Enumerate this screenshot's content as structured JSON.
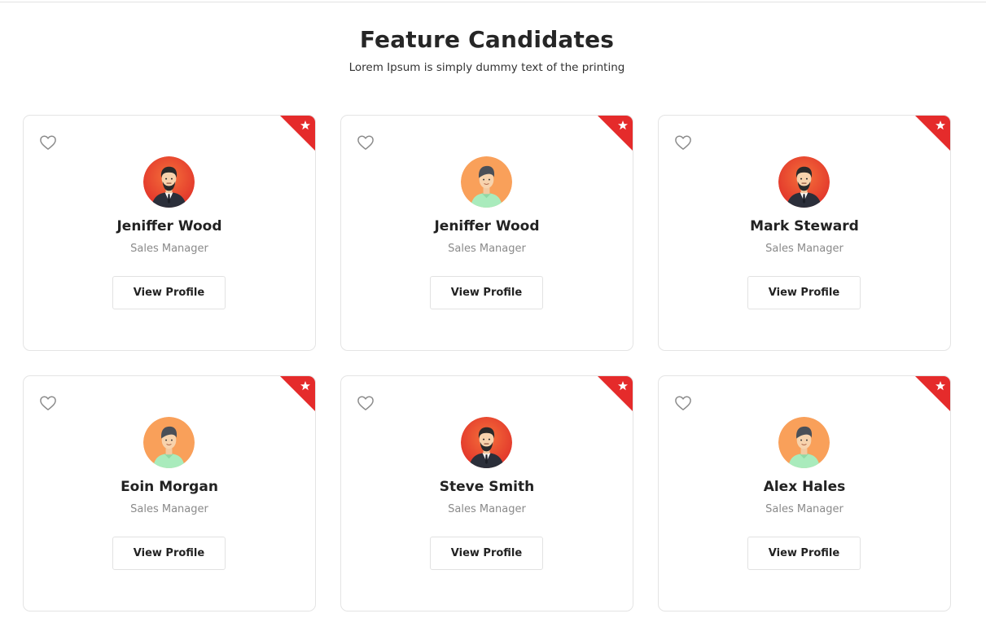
{
  "header": {
    "title": "Feature Candidates",
    "subtitle": "Lorem Ipsum is simply dummy text of the printing"
  },
  "theme": {
    "ribbon_color": "#e52b2b",
    "avatar_red": "#e8452f",
    "avatar_orange": "#f9a05a"
  },
  "candidates": [
    {
      "name": "Jeniffer Wood",
      "role": "Sales Manager",
      "button": "View Profile",
      "avatar": "businessman-avatar-icon"
    },
    {
      "name": "Jeniffer Wood",
      "role": "Sales Manager",
      "button": "View Profile",
      "avatar": "casual-man-avatar-icon"
    },
    {
      "name": "Mark Steward",
      "role": "Sales Manager",
      "button": "View Profile",
      "avatar": "businessman-avatar-icon"
    },
    {
      "name": "Eoin Morgan",
      "role": "Sales Manager",
      "button": "View Profile",
      "avatar": "casual-man-avatar-icon"
    },
    {
      "name": "Steve Smith",
      "role": "Sales Manager",
      "button": "View Profile",
      "avatar": "businessman-avatar-icon"
    },
    {
      "name": "Alex Hales",
      "role": "Sales Manager",
      "button": "View Profile",
      "avatar": "casual-man-avatar-icon"
    }
  ]
}
